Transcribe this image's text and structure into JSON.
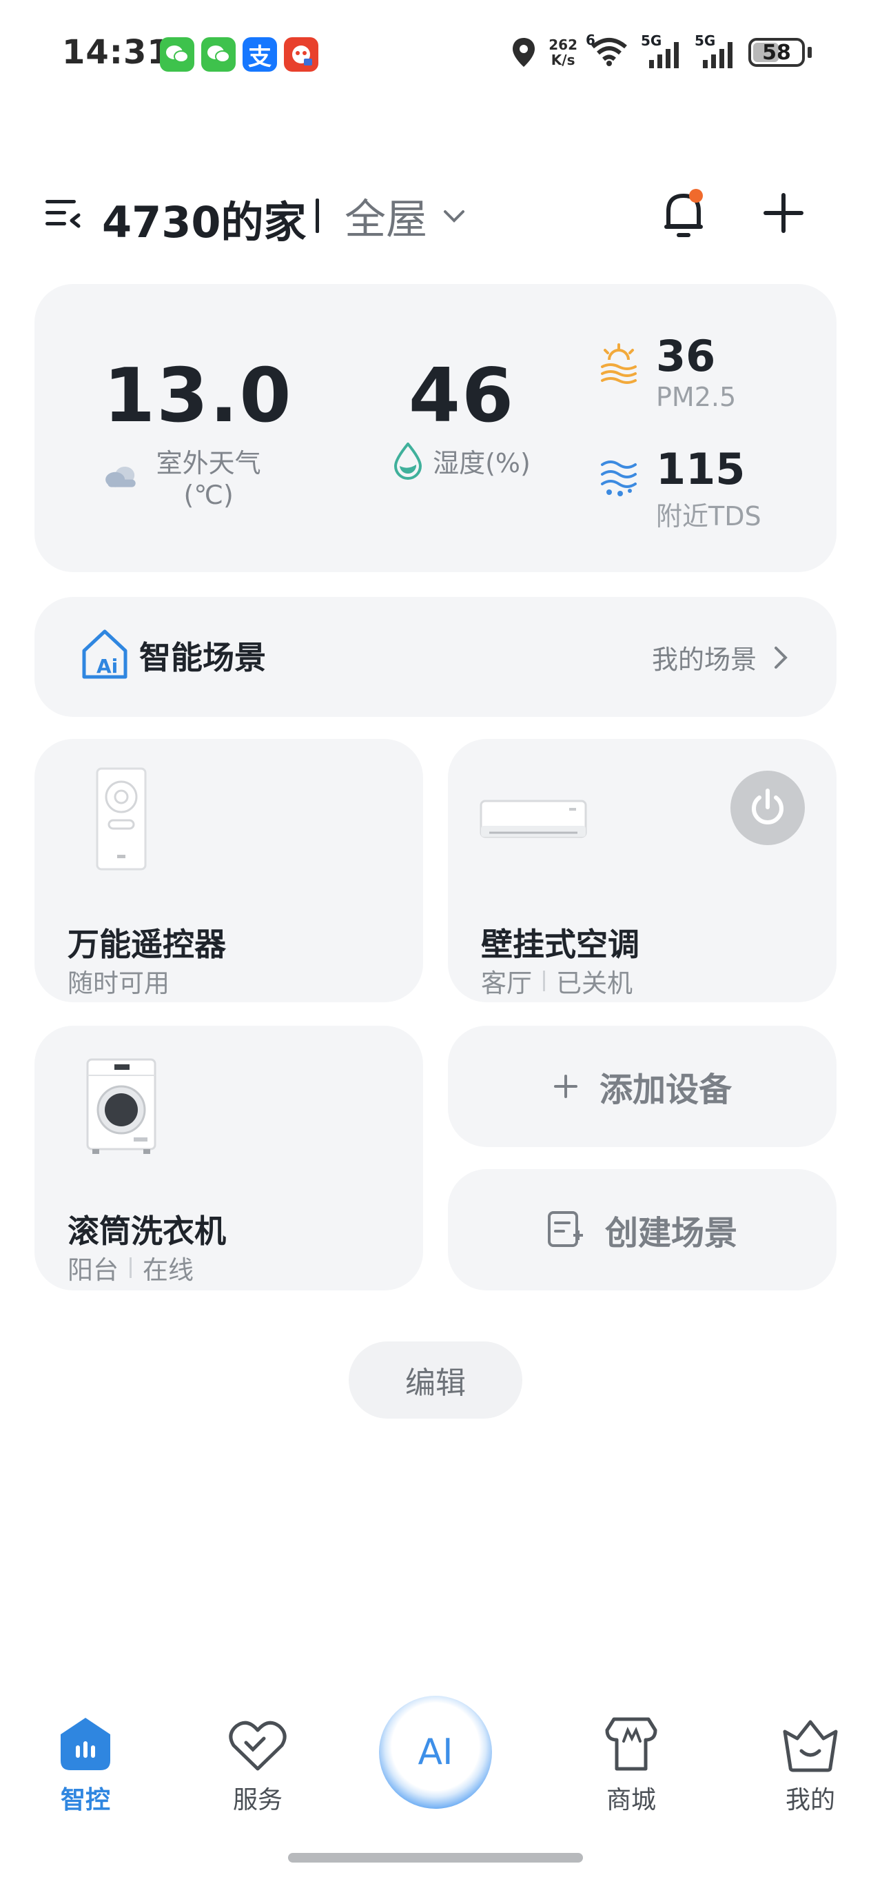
{
  "status_bar": {
    "time": "14:31",
    "app_icons": [
      {
        "name": "wechat-icon",
        "color": "#3ec24c",
        "glyph": "✉"
      },
      {
        "name": "wechat-icon",
        "color": "#3ec24c",
        "glyph": "✉"
      },
      {
        "name": "alipay-icon",
        "color": "#1677ff",
        "glyph": "支"
      },
      {
        "name": "app-icon",
        "color": "#e8402c",
        "glyph": "✿"
      }
    ],
    "net_speed_value": "262",
    "net_speed_unit": "K/s",
    "wifi_badge": "6",
    "signal_1": "5G",
    "signal_2": "5G",
    "battery": "58"
  },
  "header": {
    "home_name": "4730的家",
    "room": "全屋"
  },
  "environment": {
    "outdoor_temp": "13.0",
    "outdoor_temp_label": "室外天气(℃)",
    "humidity": "46",
    "humidity_label": "湿度(%)",
    "pm25": "36",
    "pm25_label": "PM2.5",
    "tds": "115",
    "tds_label": "附近TDS"
  },
  "scene": {
    "title": "智能场景",
    "icon_text": "Ai",
    "link": "我的场景"
  },
  "devices": [
    {
      "name": "万能遥控器",
      "status": "随时可用"
    },
    {
      "name": "壁挂式空调",
      "room": "客厅",
      "status": "已关机"
    },
    {
      "name": "滚筒洗衣机",
      "room": "阳台",
      "status": "在线"
    }
  ],
  "actions": {
    "add_device": "添加设备",
    "create_scene": "创建场景",
    "edit": "编辑"
  },
  "bottom_nav": {
    "items": [
      "智控",
      "服务",
      "商城",
      "我的"
    ],
    "ai": "AI",
    "active_color": "#2f86e0"
  }
}
